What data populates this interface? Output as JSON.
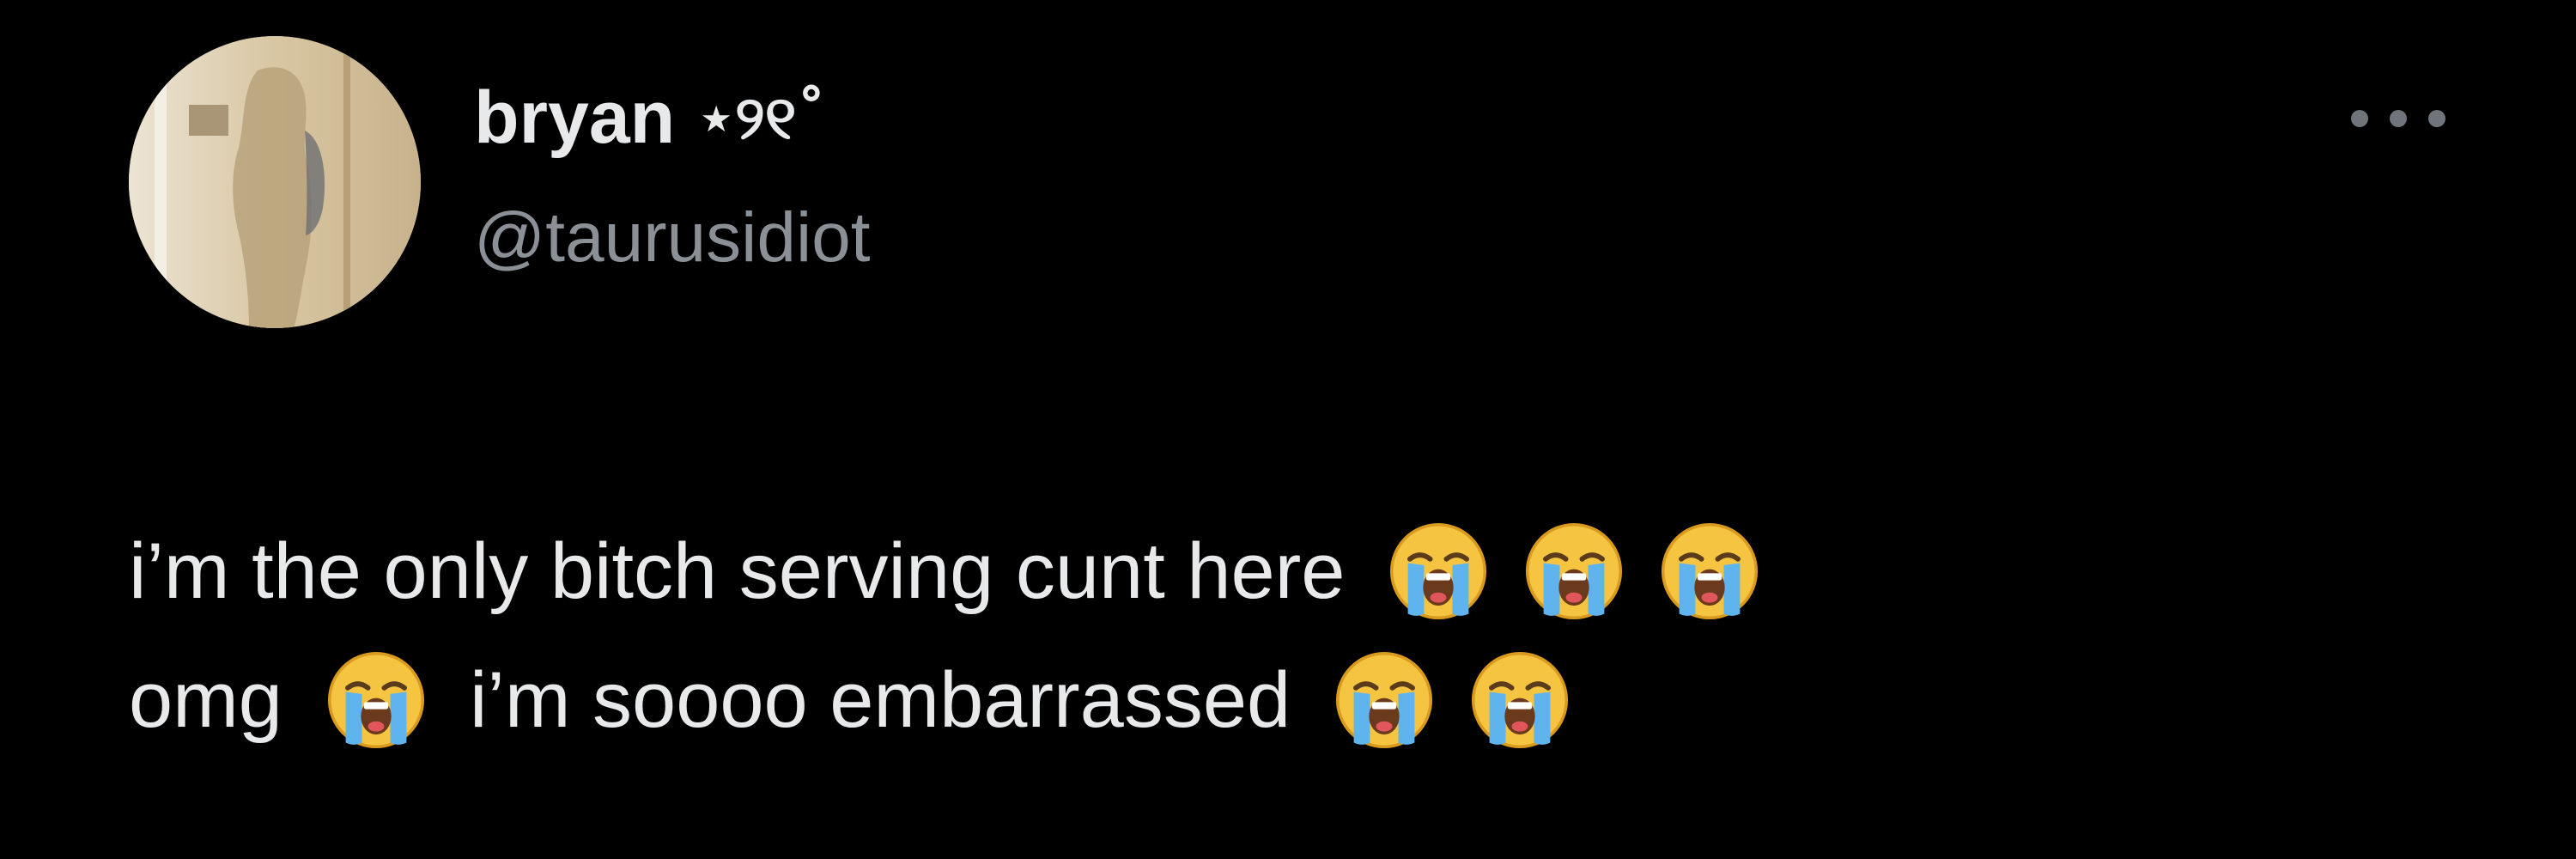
{
  "tweet": {
    "author": {
      "display_name": "bryan",
      "name_decoration": "⋆୨୧˚",
      "handle": "@taurusidiot"
    },
    "text": {
      "line1_text": "i’m the only bitch serving cunt here",
      "line2_part1": "omg",
      "line2_part2": "i’m soooo embarrassed"
    },
    "emoji_name": "loudly-crying-face",
    "more_icon": "more-horizontal-icon"
  },
  "colors": {
    "background": "#000000",
    "primary_text": "#e7e9ea",
    "secondary_text": "#8b9096"
  }
}
